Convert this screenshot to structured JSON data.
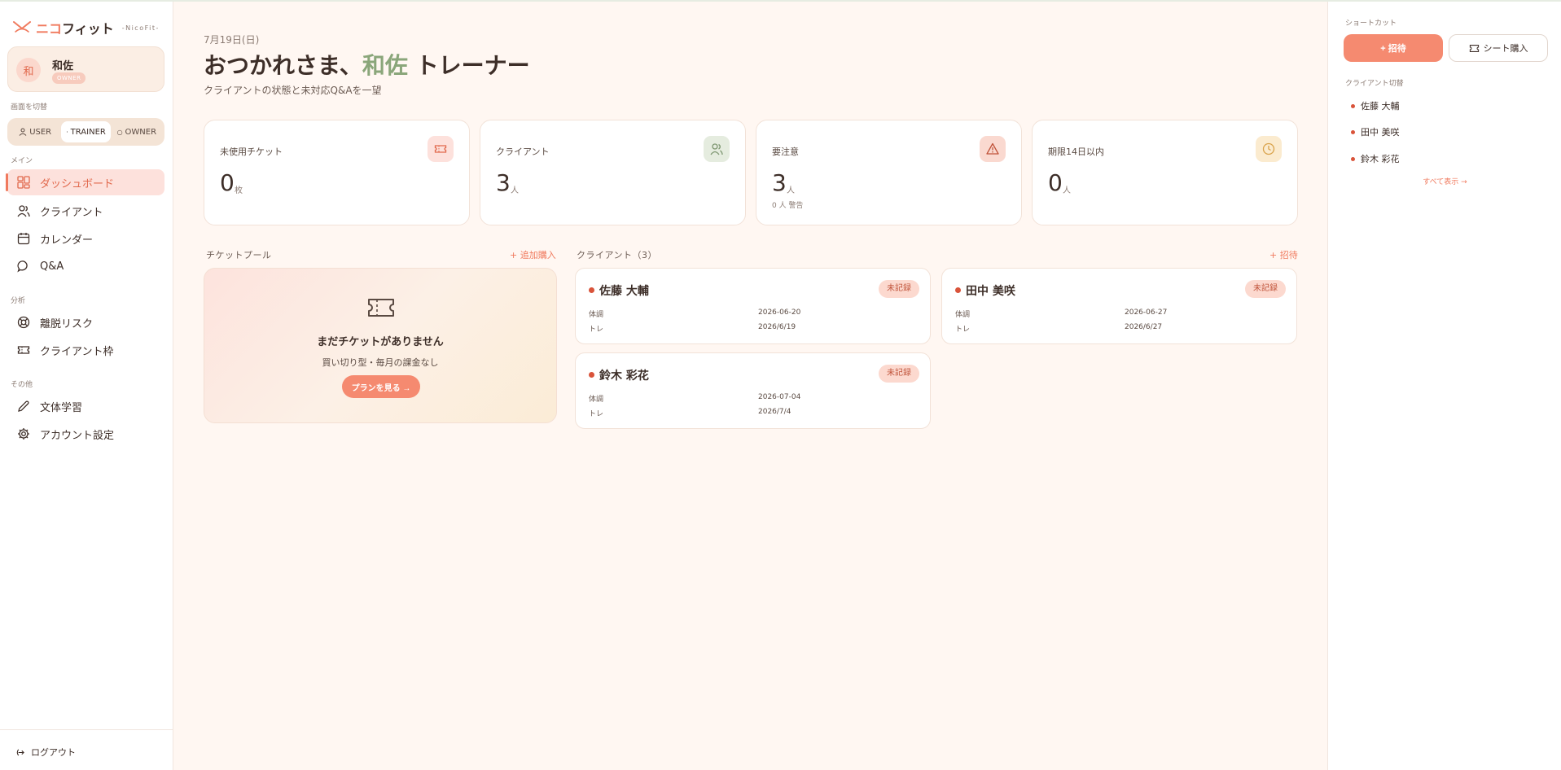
{
  "brand": {
    "name_accent": "ニコ",
    "name_rest": "フィット",
    "sub": "-NicoFit-"
  },
  "user": {
    "avatar_char": "和",
    "name": "和佐",
    "badge": "OWNER"
  },
  "sidebar": {
    "switch_label": "画面を切替",
    "roles": [
      {
        "label": "USER"
      },
      {
        "label": "TRAINER"
      },
      {
        "label": "OWNER"
      }
    ],
    "main_label": "メイン",
    "analysis_label": "分析",
    "other_label": "その他",
    "items": [
      {
        "label": "ダッシュボード"
      },
      {
        "label": "クライアント"
      },
      {
        "label": "カレンダー"
      },
      {
        "label": "Q&A"
      },
      {
        "label": "離脱リスク"
      },
      {
        "label": "クライアント枠"
      },
      {
        "label": "文体学習"
      },
      {
        "label": "アカウント設定"
      }
    ],
    "logout": "ログアウト"
  },
  "header": {
    "date": "7月19日(日)",
    "greeting_pre": "おつかれさま、",
    "greeting_name": "和佐",
    "greeting_post": " トレーナー",
    "subtitle": "クライアントの状態と未対応Q&Aを一望"
  },
  "stats": [
    {
      "label": "未使用チケット",
      "value": "0",
      "unit": "枚",
      "icon": "ticket-icon"
    },
    {
      "label": "クライアント",
      "value": "3",
      "unit": "人",
      "icon": "users-icon"
    },
    {
      "label": "要注意",
      "value": "3",
      "unit": "人",
      "note": "0 人 警告",
      "icon": "warning-icon"
    },
    {
      "label": "期限14日以内",
      "value": "0",
      "unit": "人",
      "icon": "clock-icon"
    }
  ],
  "ticket_pool": {
    "title": "チケットプール",
    "link": "+ 追加購入",
    "empty_title": "まだチケットがありません",
    "empty_sub": "買い切り型・毎月の課金なし",
    "button": "プランを見る →"
  },
  "clients_section": {
    "title": "クライアント（3）",
    "link": "+ 招待"
  },
  "clients": [
    {
      "name": "佐藤 大輔",
      "badge": "未記録",
      "row1_label": "体調",
      "row1_value": "2026-06-20",
      "row2_label": "トレ",
      "row2_value": "2026/6/19"
    },
    {
      "name": "田中 美咲",
      "badge": "未記録",
      "row1_label": "体調",
      "row1_value": "2026-06-27",
      "row2_label": "トレ",
      "row2_value": "2026/6/27"
    },
    {
      "name": "鈴木 彩花",
      "badge": "未記録",
      "row1_label": "体調",
      "row1_value": "2026-07-04",
      "row2_label": "トレ",
      "row2_value": "2026/7/4"
    }
  ],
  "right_panel": {
    "shortcut_label": "ショートカット",
    "invite_button": "+ 招待",
    "buy_button": "シート購入",
    "switch_label": "クライアント切替",
    "clients": [
      "佐藤 大輔",
      "田中 美咲",
      "鈴木 彩花"
    ],
    "show_all": "すべて表示 →"
  },
  "colors": {
    "accent": "#f07a5e",
    "accent_button": "#f58a70",
    "name_green": "#8aa67a",
    "background": "#fff7f2",
    "status_dot": "#d9533a"
  }
}
